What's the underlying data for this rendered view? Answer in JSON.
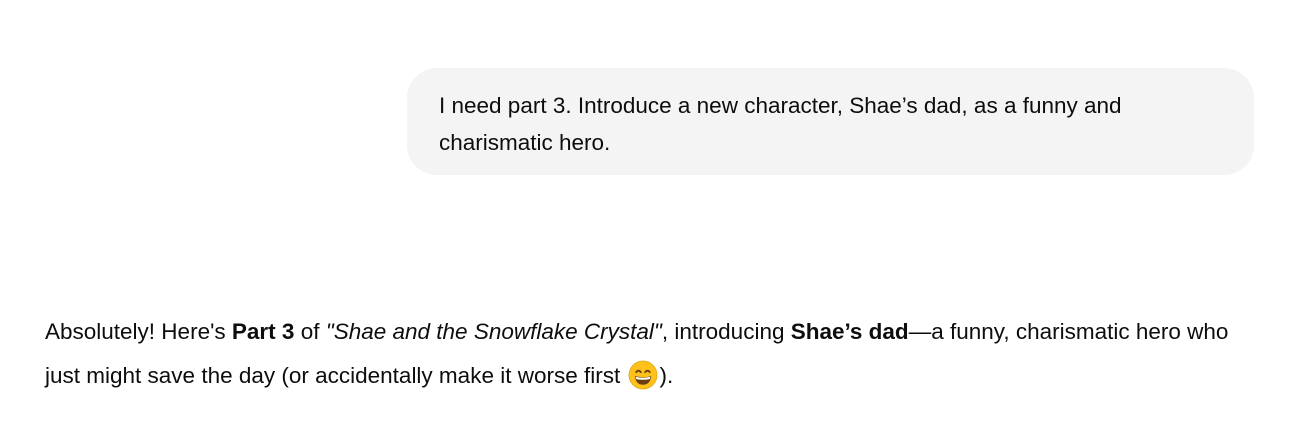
{
  "user_message": {
    "text": "I need part 3. Introduce a new character, Shae’s dad, as a funny and charismatic hero."
  },
  "assistant_message": {
    "t1": "Absolutely! Here's ",
    "t2_bold": "Part 3",
    "t3": " of ",
    "t4_italic": "\"Shae and the Snowflake Crystal\"",
    "t5": ", introducing ",
    "t6_bold": "Shae’s dad",
    "t7": "—a funny, charismatic hero who just might save the day (or accidentally make it worse first ",
    "emoji": "grinning-face-with-smiling-eyes-icon",
    "t8": ")."
  },
  "colors": {
    "user_bubble_bg": "#f4f4f4",
    "text": "#0d0d0d",
    "emoji_face": "#fcc21b"
  }
}
